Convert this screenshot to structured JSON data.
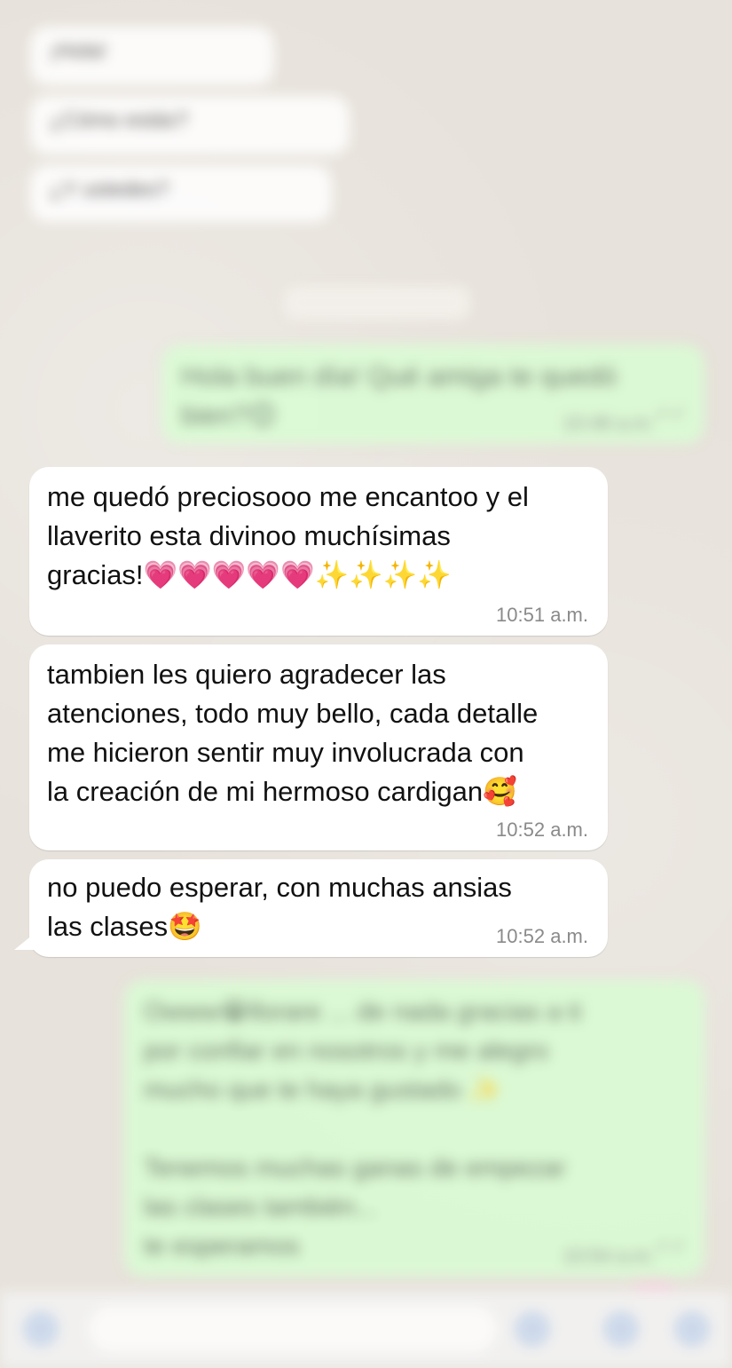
{
  "chat": {
    "previous_messages": [
      {
        "text": "¡Hola!",
        "time": ""
      },
      {
        "text": "¿Cómo estás?",
        "time": ""
      },
      {
        "text": "¿Y ustedes?",
        "time": ""
      }
    ],
    "date_chip": "",
    "outgoing_1": {
      "text": "Hola buen día! Qué amiga te quedó bien?😊",
      "time": "10:48 a.m."
    },
    "incoming": [
      {
        "text": "me quedó preciosooo me encantoo y el\nllaverito esta divinoo muchísimas\ngracias!💗💗💗💗💗✨✨✨✨",
        "time": "10:51 a.m."
      },
      {
        "text": "tambien les quiero agradecer las\natenciones, todo muy bello, cada detalle\nme hicieron sentir muy involucrada con\nla creación de mi hermoso cardigan🥰",
        "time": "10:52 a.m."
      },
      {
        "text": "no puedo esperar, con muchas ansias\nlas clases🤩",
        "time": "10:52 a.m."
      }
    ],
    "outgoing_2": {
      "text": "Owww😭llorare ... de nada gracias a ti\npor confiar en nosotros y me alegro\nmucho que te haya gustado ✨\n\nTenemos muchas ganas de empezar\nlas clases también...\nte esperamos",
      "time": "10:54 a.m."
    }
  },
  "colors": {
    "incoming_bubble": "#ffffff",
    "outgoing_bubble": "#d9fdd3",
    "chat_background": "#e7e2db",
    "timestamp": "#8a8a8a"
  },
  "icons": {
    "read_receipt": "double-check-icon",
    "composer_plus": "plus-icon",
    "camera": "camera-icon",
    "mic": "microphone-icon"
  }
}
